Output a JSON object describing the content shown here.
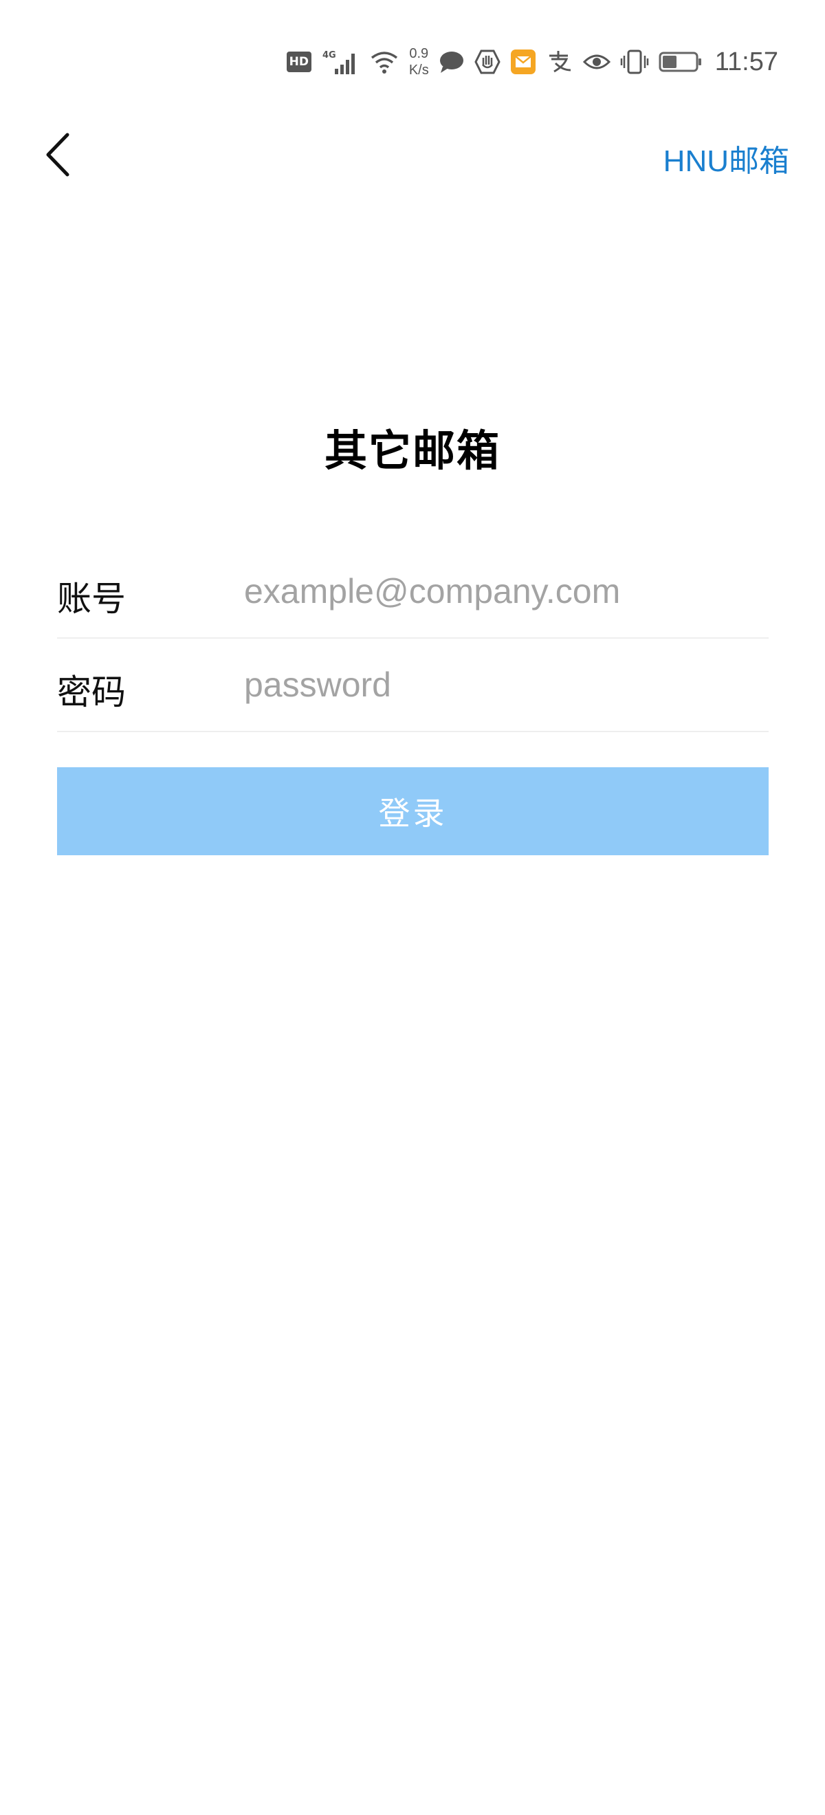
{
  "status_bar": {
    "hd_label": "HD",
    "network_type": "4G",
    "net_speed_value": "0.9",
    "net_speed_unit": "K/s",
    "time": "11:57",
    "icons": [
      "hd-icon",
      "signal-4g-icon",
      "wifi-icon",
      "chat-bubble-icon",
      "hand-shield-icon",
      "mail-app-icon",
      "alipay-icon",
      "eye-icon",
      "vibrate-icon",
      "battery-icon"
    ],
    "mail_icon_color": "#f5a623"
  },
  "nav": {
    "back_icon": "chevron-left-icon",
    "right_link": "HNU邮箱",
    "right_link_color": "#1a7fcf"
  },
  "page": {
    "title": "其它邮箱"
  },
  "form": {
    "account_label": "账号",
    "account_value": "",
    "account_placeholder": "example@company.com",
    "password_label": "密码",
    "password_value": "",
    "password_placeholder": "password",
    "login_label": "登录",
    "login_button_color": "#90caf8"
  }
}
